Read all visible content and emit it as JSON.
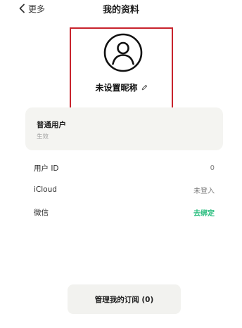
{
  "header": {
    "back_label": "更多",
    "title": "我的资料"
  },
  "profile": {
    "nickname": "未设置昵称",
    "avatar_icon": "default-user-avatar-icon",
    "edit_icon": "pencil-icon"
  },
  "membership": {
    "level": "普通用户",
    "status": "生效"
  },
  "info_rows": [
    {
      "label": "用户 ID",
      "value": "0"
    },
    {
      "label": "iCloud",
      "value": "未登入"
    },
    {
      "label": "微信",
      "value": "去绑定"
    }
  ],
  "manage_subscription_label": "管理我的订阅 (0)",
  "colors": {
    "highlight_border": "#c8232c",
    "link_green": "#29bd7e",
    "card_background": "#f4f4f1"
  }
}
